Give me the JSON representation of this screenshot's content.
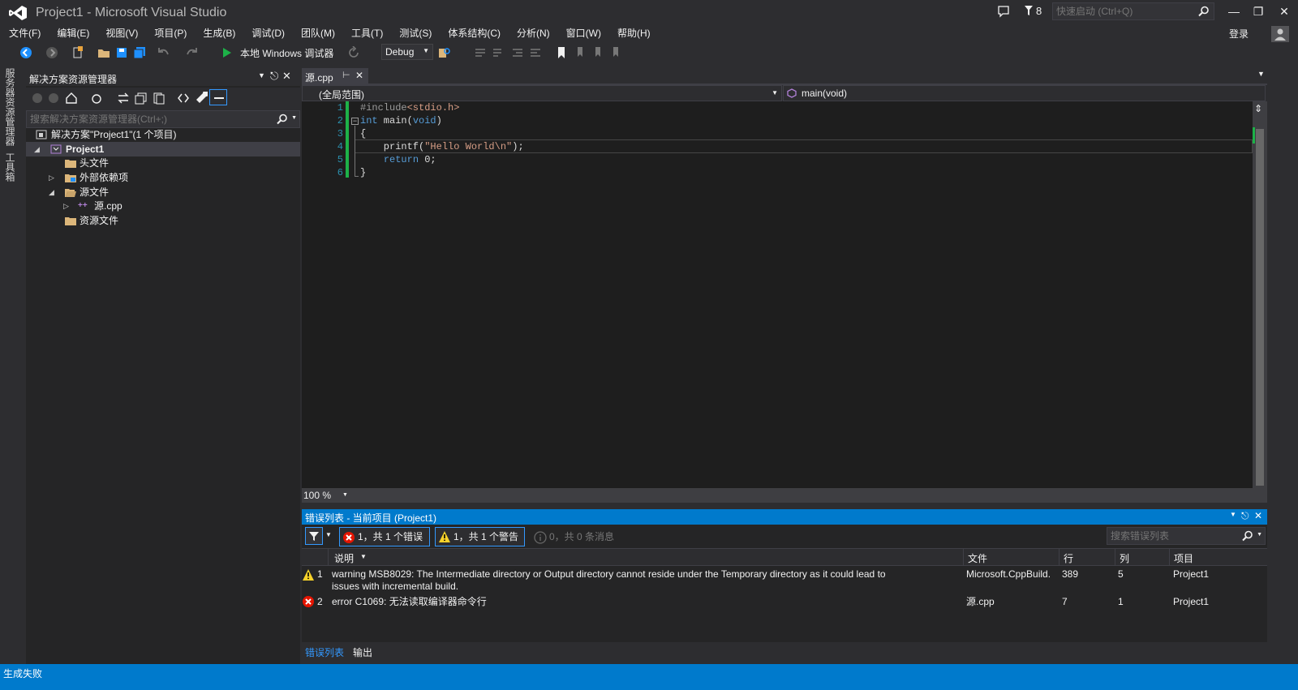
{
  "window": {
    "title": "Project1 - Microsoft Visual Studio",
    "notification_count": "8",
    "quick_launch_placeholder": "快速启动 (Ctrl+Q)",
    "sign_in": "登录"
  },
  "menu": [
    "文件(F)",
    "编辑(E)",
    "视图(V)",
    "项目(P)",
    "生成(B)",
    "调试(D)",
    "团队(M)",
    "工具(T)",
    "测试(S)",
    "体系结构(C)",
    "分析(N)",
    "窗口(W)",
    "帮助(H)"
  ],
  "toolbar": {
    "run_label": "本地 Windows 调试器",
    "configuration": "Debug"
  },
  "left_strip": {
    "server_explorer": "服务器资源管理器",
    "toolbox": "工具箱"
  },
  "solution_explorer": {
    "title": "解决方案资源管理器",
    "search_placeholder": "搜索解决方案资源管理器(Ctrl+;)",
    "solution": "解决方案\"Project1\"(1 个项目)",
    "project": "Project1",
    "header_files": "头文件",
    "external_deps": "外部依赖项",
    "source_files": "源文件",
    "source_cpp": "源.cpp",
    "resource_files": "资源文件"
  },
  "editor": {
    "tab": "源.cpp",
    "scope_left": "(全局范围)",
    "scope_right": "main(void)",
    "zoom": "100 %",
    "lines": [
      "1",
      "2",
      "3",
      "4",
      "5",
      "6"
    ]
  },
  "error_list": {
    "title": "错误列表 - 当前项目 (Project1)",
    "errors_btn": "1，共 1 个错误",
    "warnings_btn": "1，共 1 个警告",
    "messages_btn": "0，共 0 条消息",
    "search_placeholder": "搜索错误列表",
    "columns": {
      "description": "说明",
      "file": "文件",
      "line": "行",
      "column": "列",
      "project": "项目"
    },
    "rows": [
      {
        "num": "1",
        "desc_l1": "warning MSB8029: The Intermediate directory or Output directory cannot reside under the Temporary directory as it could lead to",
        "desc_l2": "issues with incremental build.",
        "file": "Microsoft.CppBuild.",
        "line": "389",
        "column": "5",
        "project": "Project1"
      },
      {
        "num": "2",
        "desc_l1": "error C1069: 无法读取编译器命令行",
        "file": "源.cpp",
        "line": "7",
        "column": "1",
        "project": "Project1"
      }
    ]
  },
  "bottom_tabs": {
    "error_list": "错误列表",
    "output": "输出"
  },
  "status": "生成失败",
  "colors": {
    "accent": "#007acc",
    "keyword": "#569cd6",
    "string": "#d69d85",
    "preprocessor": "#9b9b9b"
  }
}
